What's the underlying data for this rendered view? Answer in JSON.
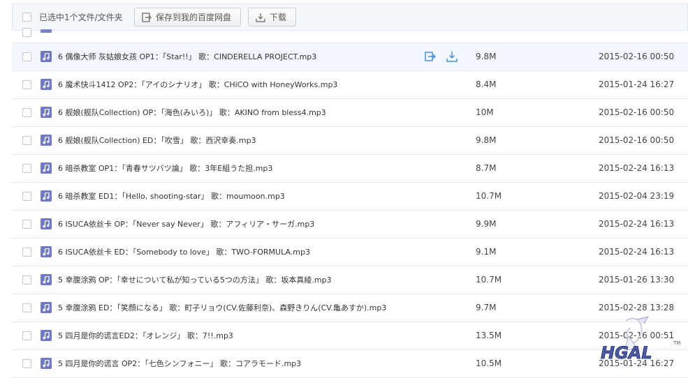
{
  "toolbar": {
    "selected_text": "已选中1个文件/文件夹",
    "save_label": "保存到我的百度网盘",
    "download_label": "下载"
  },
  "files": [
    {
      "name": "6 偶像大师 灰姑娘女孩 OP1：「Star!!」  歌：CINDERELLA PROJECT.mp3",
      "size": "9.8M",
      "date": "2015-02-16 00:50",
      "hover": true
    },
    {
      "name": "6 魔术快斗1412 OP2：「アイのシナリオ」  歌：CHiCO with HoneyWorks.mp3",
      "size": "8.4M",
      "date": "2015-01-24 16:27"
    },
    {
      "name": "6 舰娘(舰队Collection) OP：「海色(みいろ)」  歌：AKINO from bless4.mp3",
      "size": "10M",
      "date": "2015-02-16 00:50"
    },
    {
      "name": "6 舰娘(舰队Collection) ED：「吹雪」  歌：西沢幸奏.mp3",
      "size": "9.8M",
      "date": "2015-02-16 00:50"
    },
    {
      "name": "6 暗杀教室 OP1：「青春サツバツ論」  歌：3年E組うた担.mp3",
      "size": "8.7M",
      "date": "2015-02-24 16:13"
    },
    {
      "name": "6 暗杀教室 ED1：「Hello, shooting-star」  歌：moumoon.mp3",
      "size": "10.7M",
      "date": "2015-02-04 23:19"
    },
    {
      "name": "6 ISUCA依丝卡 OP：「Never say Never」  歌：アフィリア・サーガ.mp3",
      "size": "9.9M",
      "date": "2015-02-24 16:13"
    },
    {
      "name": "6 ISUCA依丝卡 ED：「Somebody to love」  歌：TWO-FORMULA.mp3",
      "size": "9.1M",
      "date": "2015-02-24 16:13"
    },
    {
      "name": "5 幸腹涂鸦 OP：「幸せについて私が知っている5つの方法」  歌：坂本真綾.mp3",
      "size": "10.7M",
      "date": "2015-01-26 13:30"
    },
    {
      "name": "5 幸腹涂鸦 ED：「笑顔になる」  歌：町子リョウ(CV.佐藤利奈)、森野きりん(CV.亀あすか).mp3",
      "size": "9.7M",
      "date": "2015-02-28 13:28"
    },
    {
      "name": "5 四月是你的谎言ED2：「オレンジ」  歌：7!!.mp3",
      "size": "13.5M",
      "date": "2015-02-16 00:51"
    },
    {
      "name": "5 四月是你的谎言 OP2：「七色シンフォニー」  歌：コアラモード.mp3",
      "size": "10.5M",
      "date": "2015-01-24 16:27"
    }
  ],
  "watermark": {
    "text": "HGAL",
    "tm": "TM"
  },
  "colors": {
    "music_icon": "#6f78c8",
    "row_border": "#e6e9ed",
    "hover_bg": "#f2f6fd",
    "accent_icon": "#4a90d9"
  }
}
